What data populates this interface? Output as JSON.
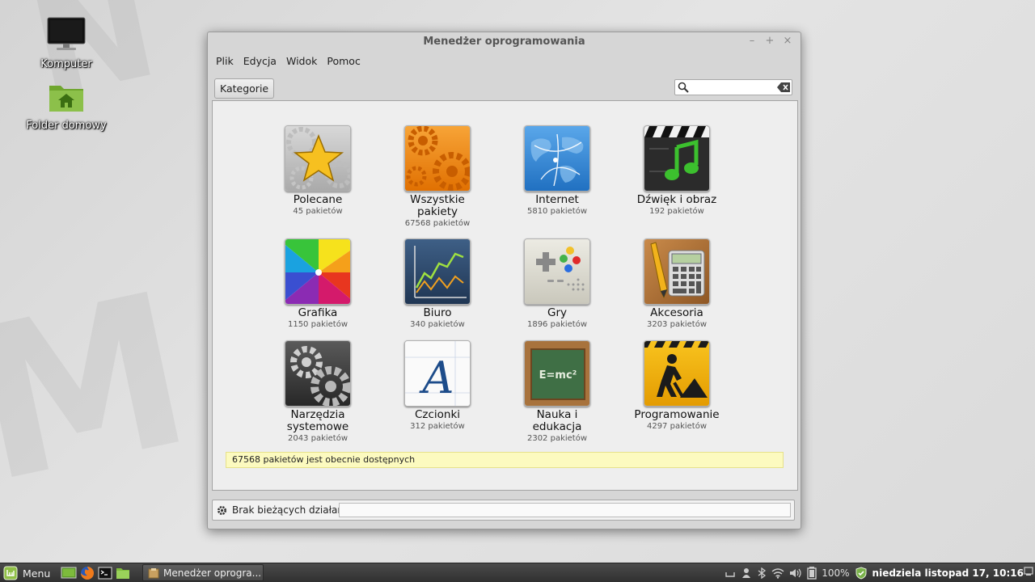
{
  "desktop": {
    "icons": [
      {
        "label": "Komputer"
      },
      {
        "label": "Folder domowy"
      }
    ]
  },
  "window": {
    "title": "Menedżer oprogramowania",
    "controls": {
      "minimize": "–",
      "maximize": "+",
      "close": "×"
    },
    "menu": [
      "Plik",
      "Edycja",
      "Widok",
      "Pomoc"
    ],
    "toolbar": {
      "categories_button": "Kategorie",
      "search_placeholder": ""
    },
    "categories": [
      {
        "name": "Polecane",
        "count": "45 pakietów",
        "icon": "star-gears-icon"
      },
      {
        "name": "Wszystkie pakiety",
        "count": "67568 pakietów",
        "icon": "orange-gears-icon"
      },
      {
        "name": "Internet",
        "count": "5810 pakietów",
        "icon": "globe-network-icon"
      },
      {
        "name": "Dźwięk i obraz",
        "count": "192 pakietów",
        "icon": "clapperboard-music-icon"
      },
      {
        "name": "Grafika",
        "count": "1150 pakietów",
        "icon": "color-wheel-icon"
      },
      {
        "name": "Biuro",
        "count": "340 pakietów",
        "icon": "line-chart-icon"
      },
      {
        "name": "Gry",
        "count": "1896 pakietów",
        "icon": "gamepad-icon"
      },
      {
        "name": "Akcesoria",
        "count": "3203 pakietów",
        "icon": "calculator-pencil-icon"
      },
      {
        "name": "Narzędzia systemowe",
        "count": "2043 pakietów",
        "icon": "dark-gears-icon"
      },
      {
        "name": "Czcionki",
        "count": "312 pakietów",
        "icon": "font-letter-icon"
      },
      {
        "name": "Nauka i edukacja",
        "count": "2302 pakietów",
        "icon": "chalkboard-icon"
      },
      {
        "name": "Programowanie",
        "count": "4297 pakietów",
        "icon": "construction-sign-icon"
      }
    ],
    "notice": "67568 pakietów jest obecnie dostępnych",
    "status": "Brak bieżących działań"
  },
  "taskbar": {
    "menu_label": "Menu",
    "window_button": "Menedżer oprogra...",
    "battery": "100%",
    "clock": "niedziela listopad 17, 10:16"
  },
  "colors": {
    "taskbar_bg": "#3a3a3a",
    "mint_green": "#8fbf46",
    "notice_bg": "#fcfabf"
  }
}
